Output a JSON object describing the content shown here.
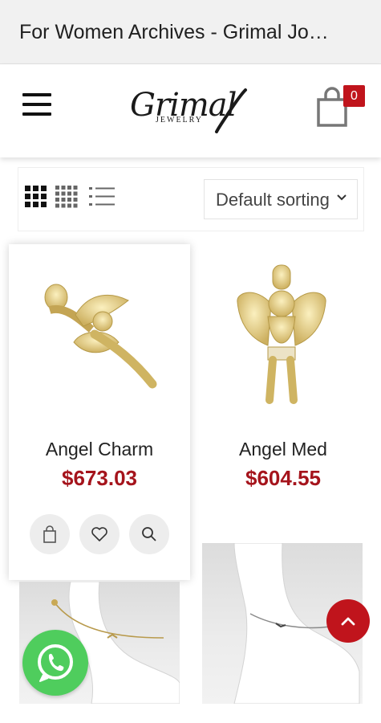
{
  "page": {
    "title": "For Women Archives - Grimal Jo…"
  },
  "header": {
    "logo_script": "Grimal",
    "logo_sub": "JEWELRY",
    "cart_count": "0"
  },
  "toolbar": {
    "views": [
      "grid-large-icon",
      "grid-small-icon",
      "list-icon"
    ],
    "sort_label": "Default sorting"
  },
  "products": [
    {
      "name": "Angel Charm",
      "price": "$673.03"
    },
    {
      "name": "Angel Med",
      "price": "$604.55"
    }
  ],
  "colors": {
    "accent": "#a5141c",
    "badge": "#c0141c",
    "whatsapp": "#4fcd5d"
  }
}
